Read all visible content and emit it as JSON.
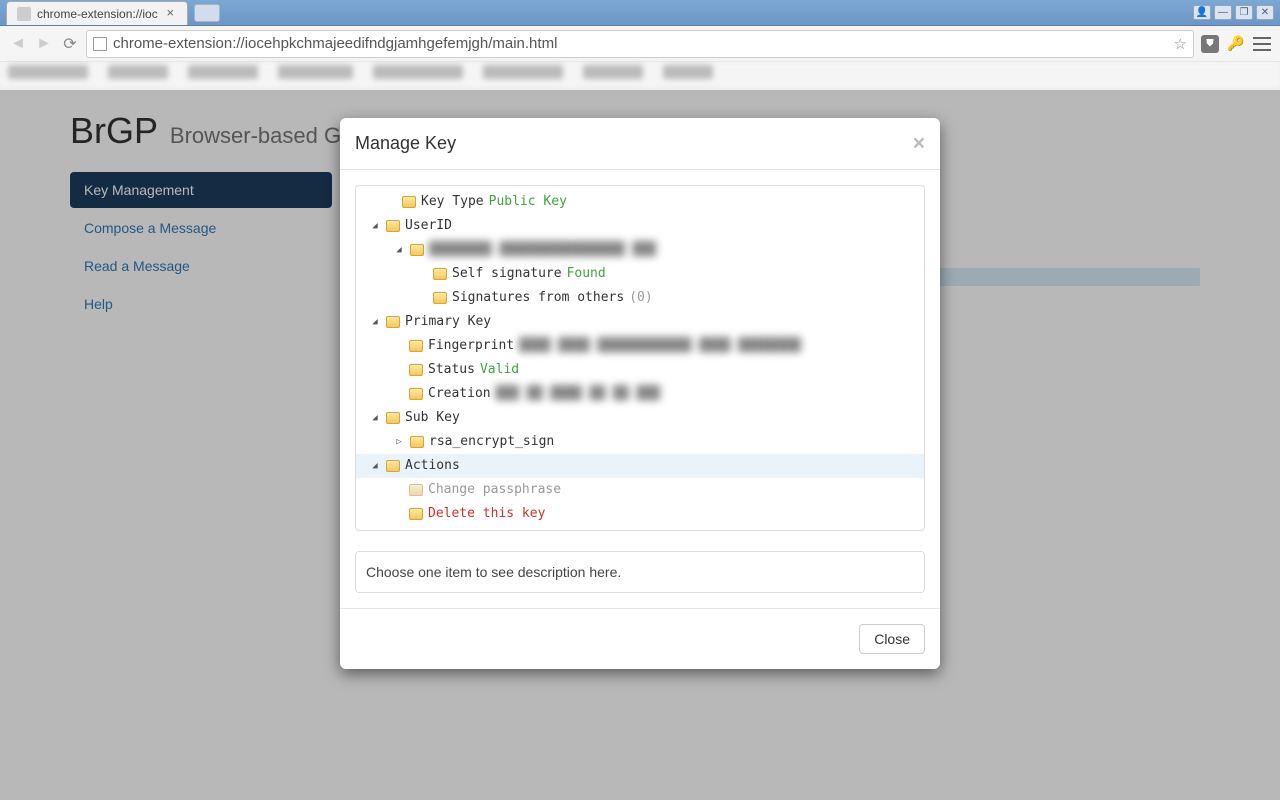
{
  "browser": {
    "tab_title": "chrome-extension://ioc",
    "url": "chrome-extension://iocehpkchmajeedifndgjamhgefemjgh/main.html"
  },
  "page": {
    "title": "BrGP",
    "subtitle": "Browser-based G"
  },
  "sidebar": {
    "items": [
      {
        "label": "Key Management",
        "active": true
      },
      {
        "label": "Compose a Message",
        "active": false
      },
      {
        "label": "Read a Message",
        "active": false
      },
      {
        "label": "Help",
        "active": false
      }
    ]
  },
  "modal": {
    "title": "Manage Key",
    "close_label": "Close",
    "description_placeholder": "Choose one item to see description here."
  },
  "tree": {
    "key_type_label": "Key Type",
    "key_type_value": "Public Key",
    "userid_label": "UserID",
    "userid_value": "████████ ████████████████ ███",
    "self_sig_label": "Self signature",
    "self_sig_value": "Found",
    "other_sig_label": "Signatures from others",
    "other_sig_value": "(0)",
    "primary_key_label": "Primary Key",
    "fingerprint_label": "Fingerprint",
    "fingerprint_value": "████ ████ ████████████ ████ ████████",
    "status_label": "Status",
    "status_value": "Valid",
    "creation_label": "Creation",
    "creation_value": "███ ██ ████ ██ ██ ███",
    "subkey_label": "Sub Key",
    "subkey_child": "rsa_encrypt_sign",
    "actions_label": "Actions",
    "change_passphrase": "Change passphrase",
    "delete_key": "Delete this key"
  }
}
